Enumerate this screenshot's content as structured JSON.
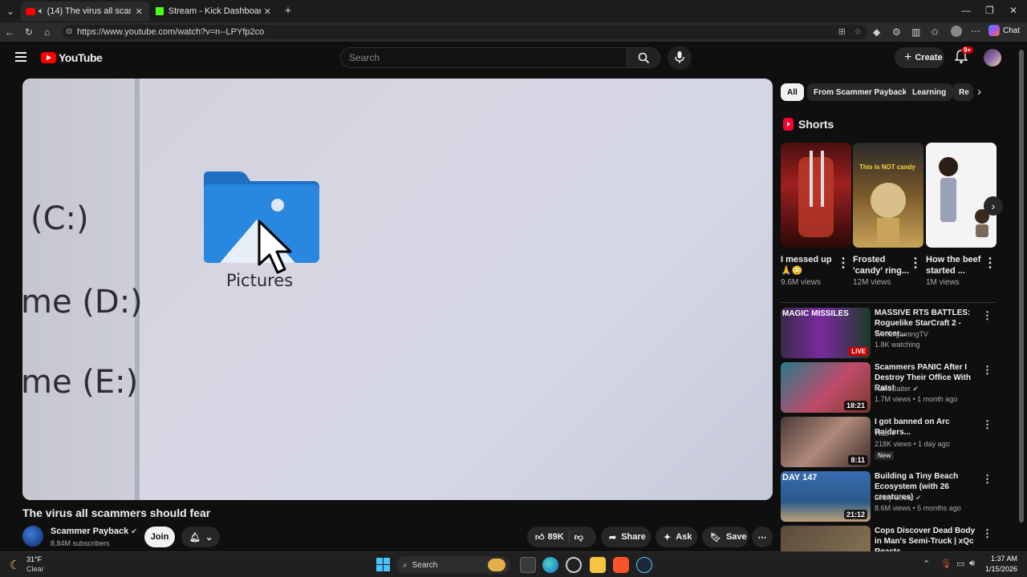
{
  "browser": {
    "tabs": [
      {
        "label": "(14) The virus all scammers sh",
        "active": true
      },
      {
        "label": "Stream - Kick Dashboard",
        "active": false
      }
    ],
    "url": "https://www.youtube.com/watch?v=n--LPYfp2co",
    "chat_label": "Chat"
  },
  "youtube": {
    "logo": "YouTube",
    "search_placeholder": "Search",
    "create_label": "Create",
    "notif_badge": "9+"
  },
  "video": {
    "drives": [
      "(C:)",
      "me (D:)",
      "me (E:)"
    ],
    "folder_label": "Pictures",
    "title": "The virus all scammers should fear",
    "channel": "Scammer Payback",
    "subscribers": "8.84M subscribers",
    "join_label": "Join",
    "likes": "89K",
    "share_label": "Share",
    "ask_label": "Ask",
    "save_label": "Save"
  },
  "chips": [
    "All",
    "From Scammer Payback",
    "Learning",
    "Re"
  ],
  "shorts": {
    "heading": "Shorts",
    "overlay_text": "This is NOT candy",
    "items": [
      {
        "title": "I messed up",
        "title2": "🙏😳",
        "views": "9.6M views"
      },
      {
        "title": "Frosted",
        "title2": "'candy' ring...",
        "views": "12M views"
      },
      {
        "title": "How the beef",
        "title2": "started ...",
        "views": "1M views"
      }
    ]
  },
  "recommended": [
    {
      "title": "MASSIVE RTS BATTLES: Roguelike StarCraft 2 - Sorcer...",
      "channel": "WintergamingTV",
      "meta": "1.8K watching",
      "badge": "LIVE",
      "thumb_text": "MAGIC MISSILES"
    },
    {
      "title": "Scammers PANIC After I Destroy Their Office With Rats!",
      "channel": "NanoBaiter",
      "meta": "1.7M views • 1 month ago",
      "duration": "18:21"
    },
    {
      "title": "I got banned on Arc Raiders...",
      "channel": "Tfue",
      "meta": "218K views • 1 day ago",
      "tag": "New",
      "duration": "8:11"
    },
    {
      "title": "Building a Tiny Beach Ecosystem (with 26 creatures)",
      "channel": "Leafy Street",
      "meta": "8.6M views • 5 months ago",
      "duration": "21:12",
      "thumb_text": "DAY 147"
    },
    {
      "title": "Cops Discover Dead Body in Man's Semi-Truck | xQc Reacts",
      "channel": "",
      "meta": ""
    }
  ],
  "taskbar": {
    "weather_temp": "31°F",
    "weather_desc": "Clear",
    "search_label": "Search",
    "time": "1:37 AM",
    "date": "1/15/2026"
  },
  "colors": {
    "yt_red": "#ff0000",
    "bg": "#0f0f0f",
    "folder_blue": "#2a7fd4"
  }
}
